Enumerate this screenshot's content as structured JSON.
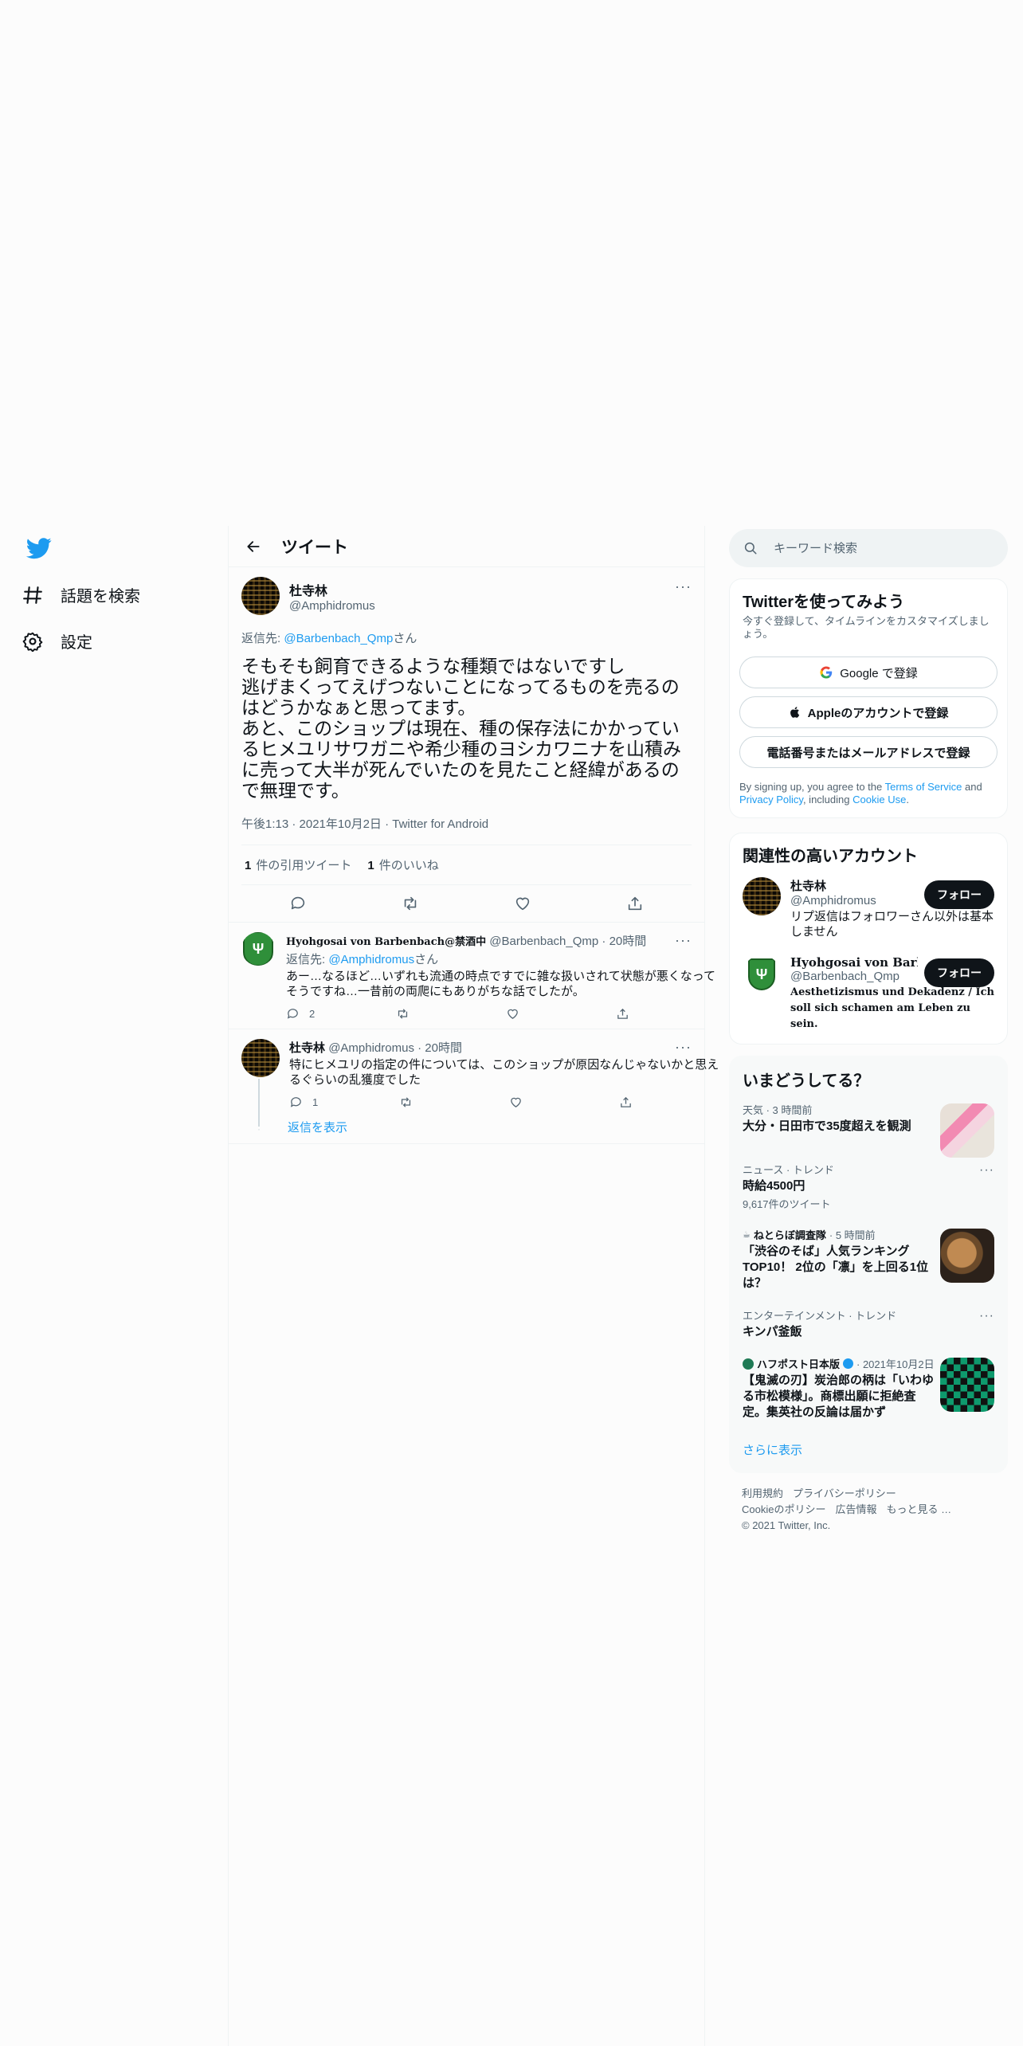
{
  "nav": {
    "items": [
      {
        "label": "話題を検索",
        "icon": "hashtag-icon"
      },
      {
        "label": "設定",
        "icon": "gear-icon"
      }
    ]
  },
  "header": {
    "title": "ツイート"
  },
  "tweet": {
    "author_name": "杜寺林",
    "author_handle": "@Amphidromus",
    "reply_to_label": "返信先: ",
    "reply_to_handle": "@Barbenbach_Qmp",
    "reply_to_suffix": "さん",
    "text": "そもそも飼育できるような種類ではないですし\n逃げまくってえげつないことになってるものを売るのはどうかなぁと思ってます。\nあと、このショップは現在、種の保存法にかかっているヒメユリサワガニや希少種のヨシカワニナを山積みに売って大半が死んでいたのを見たこと経緯があるので無理です。",
    "meta": "午後1:13 · 2021年10月2日 · Twitter for Android",
    "quote_count": "1",
    "quote_label": "件の引用ツイート",
    "like_count": "1",
    "like_label": "件のいいね"
  },
  "replies": [
    {
      "name": "Hyohgosai von Barbenbach@禁酒中",
      "handle": "@Barbenbach_Qmp",
      "time": "· 20時間",
      "reply_to_label": "返信先: ",
      "reply_to_handle": "@Amphidromus",
      "reply_to_suffix": "さん",
      "text": "あー…なるほど…いずれも流通の時点ですでに雑な扱いされて状態が悪くなってそうですね…一昔前の両爬にもありがちな話でしたが。",
      "reply_count": "2"
    },
    {
      "name": "杜寺林",
      "handle": "@Amphidromus",
      "time": "· 20時間",
      "text": "特にヒメユリの指定の件については、このショップが原因なんじゃないかと思えるぐらいの乱獲度でした",
      "reply_count": "1"
    }
  ],
  "show_replies": "返信を表示",
  "search": {
    "placeholder": "キーワード検索"
  },
  "signup": {
    "title": "Twitterを使ってみよう",
    "subtitle": "今すぐ登録して、タイムラインをカスタマイズしましょう。",
    "google": "Google で登録",
    "apple": "Appleのアカウントで登録",
    "phone": "電話番号またはメールアドレスで登録",
    "legal_1": "By signing up, you agree to the ",
    "legal_tos": "Terms of Service",
    "legal_2": " and ",
    "legal_pp": "Privacy Policy",
    "legal_3": ", including ",
    "legal_cookie": "Cookie Use",
    "legal_4": "."
  },
  "relevant": {
    "title": "関連性の高いアカウント",
    "follow_label": "フォロー",
    "accounts": [
      {
        "name": "杜寺林",
        "handle": "@Amphidromus",
        "bio": "リプ返信はフォロワーさん以外は基本しません"
      },
      {
        "name": "Hyohgosai von Barbenba",
        "handle": "@Barbenbach_Qmp",
        "bio": "Aesthetizismus und Dekadenz / Ich soll sich schamen am Leben zu sein."
      }
    ]
  },
  "trends": {
    "title": "いまどうしてる？",
    "items": [
      {
        "meta": "天気 · 3 時間前",
        "title": "大分・日田市で35度超えを観測"
      },
      {
        "meta": "ニュース · トレンド",
        "title": "時給4500円",
        "count": "9,617件のツイート"
      },
      {
        "source": "ねとらぼ調査隊",
        "meta": "· 5 時間前",
        "title": "「渋谷のそば」人気ランキングTOP10！ 2位の「凛」を上回る1位は？"
      },
      {
        "meta": "エンターテインメント · トレンド",
        "title": "キンパ釜飯"
      },
      {
        "source": "ハフポスト日本版",
        "meta": "· 2021年10月2日",
        "title": "【鬼滅の刃】炭治郎の柄は「いわゆる市松模様」。商標出願に拒絶査定。集英社の反論は届かず"
      }
    ],
    "show_more": "さらに表示"
  },
  "footer": {
    "links": [
      "利用規約",
      "プライバシーポリシー",
      "Cookieのポリシー",
      "広告情報",
      "もっと見る …"
    ],
    "copyright": "© 2021 Twitter, Inc."
  }
}
